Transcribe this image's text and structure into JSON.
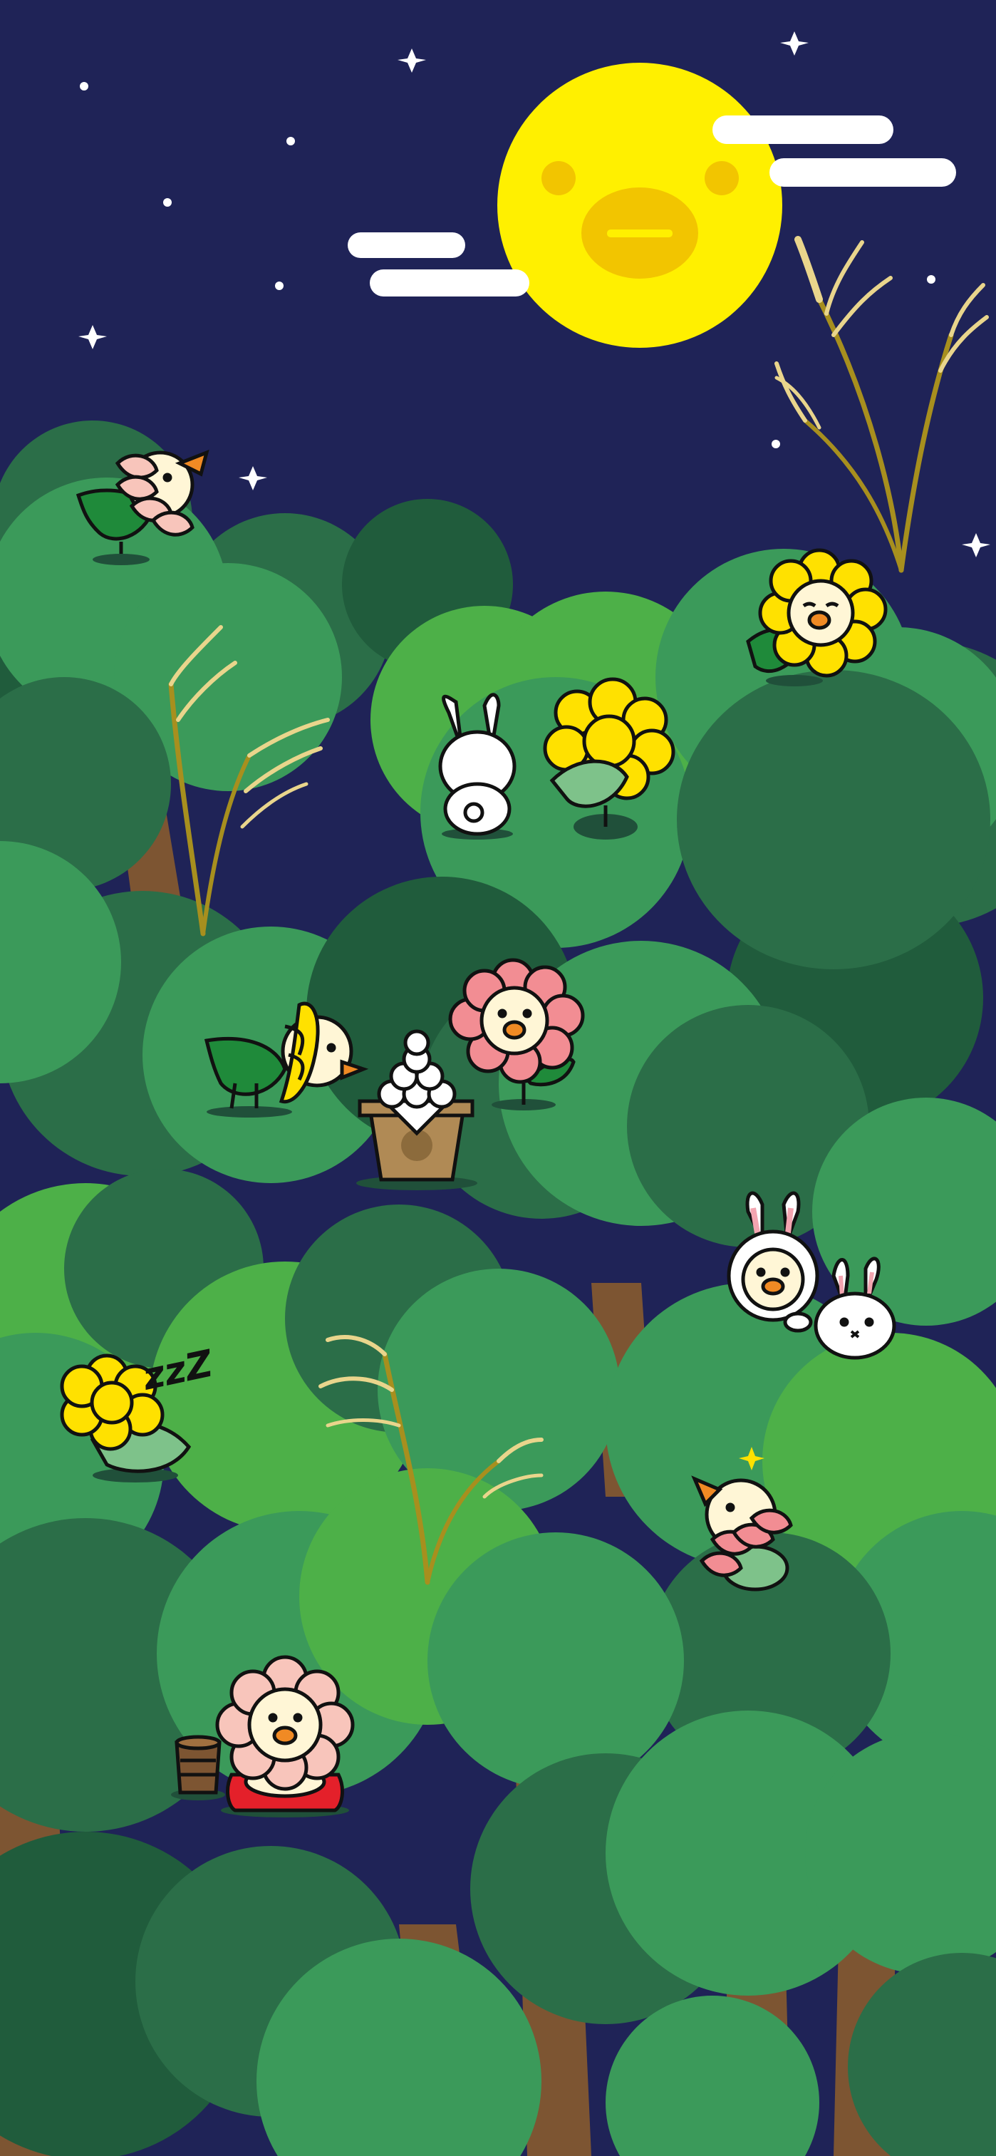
{
  "scene": {
    "colors": {
      "sky": "#1f2357",
      "moon": "#fff000",
      "moon_face": "#f2c500",
      "cloud": "#ffffff",
      "star": "#ffffff",
      "tree_dark": "#2b6e48",
      "tree_mid": "#3b9a5a",
      "tree_light": "#4db048",
      "tree_deep": "#205c3c",
      "trunk": "#7d5532",
      "grass_gold": "#e9d58c",
      "grass_stem": "#a78f1e",
      "chick_body": "#fff6d6",
      "beak": "#f08a24",
      "outline": "#111111",
      "flower_yellow": "#ffe100",
      "flower_pink": "#f28d93",
      "flower_peach": "#f8c5bb",
      "leaf_green": "#1f8a3a",
      "leaf_pale": "#7ec28a",
      "rabbit_ear_pink": "#f3a5b0",
      "box_brown": "#b08a55",
      "cushion_red": "#e4202a"
    },
    "elements": [
      "moon-chick-face",
      "clouds",
      "stars",
      "pampas-grass",
      "tree-canopy",
      "chick-in-peach-flower-with-leaf",
      "yellow-sunflower-chick",
      "white-rabbit-back-view",
      "yellow-flower-pom-with-leaf",
      "chick-in-yellow-banana-petal",
      "pink-flower-chick",
      "tsukimi-dango-offering",
      "chick-in-rabbit-costume",
      "white-rabbit-peeking",
      "sleeping-yellow-flower-chick",
      "chick-in-pink-flower-hat",
      "peach-flower-chick-on-red-cushion",
      "tea-cup"
    ]
  },
  "texts": {
    "sleep": "zzZ"
  }
}
